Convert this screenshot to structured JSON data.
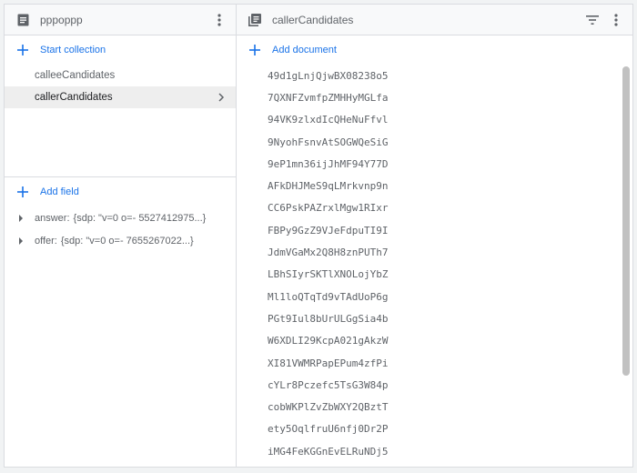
{
  "collections_panel": {
    "title": "pppoppp",
    "start_collection_label": "Start collection",
    "items": [
      {
        "label": "calleeCandidates",
        "selected": false
      },
      {
        "label": "callerCandidates",
        "selected": true
      }
    ],
    "add_field_label": "Add field",
    "fields": [
      {
        "key": "answer:",
        "value": "{sdp: \"v=0 o=- 5527412975...}"
      },
      {
        "key": "offer:",
        "value": "{sdp: \"v=0 o=- 7655267022...}"
      }
    ]
  },
  "documents_panel": {
    "title": "callerCandidates",
    "add_document_label": "Add document",
    "documents": [
      "49d1gLnjQjwBX08238o5",
      "7QXNFZvmfpZMHHyMGLfa",
      "94VK9zlxdIcQHeNuFfvl",
      "9NyohFsnvAtSOGWQeSiG",
      "9eP1mn36ijJhMF94Y77D",
      "AFkDHJMeS9qLMrkvnp9n",
      "CC6PskPAZrxlMgw1RIxr",
      "FBPy9GzZ9VJeFdpuTI9I",
      "JdmVGaMx2Q8H8znPUTh7",
      "LBhSIyrSKTlXNOLojYbZ",
      "Ml1loQTqTd9vTAdUoP6g",
      "PGt9Iul8bUrULGgSia4b",
      "W6XDLI29KcpA021gAkzW",
      "XI81VWMRPapEPum4zfPi",
      "cYLr8Pczefc5TsG3W84p",
      "cobWKPlZvZbWXY2QBztT",
      "ety5OqlfruU6nfj0Dr2P",
      "iMG4FeKGGnEvELRuNDj5"
    ]
  },
  "colors": {
    "accent": "#1a73e8",
    "text_secondary": "#5f6368",
    "border": "#dadce0",
    "header_bg": "#f8f9fa",
    "selected_bg": "#eeeeee"
  }
}
